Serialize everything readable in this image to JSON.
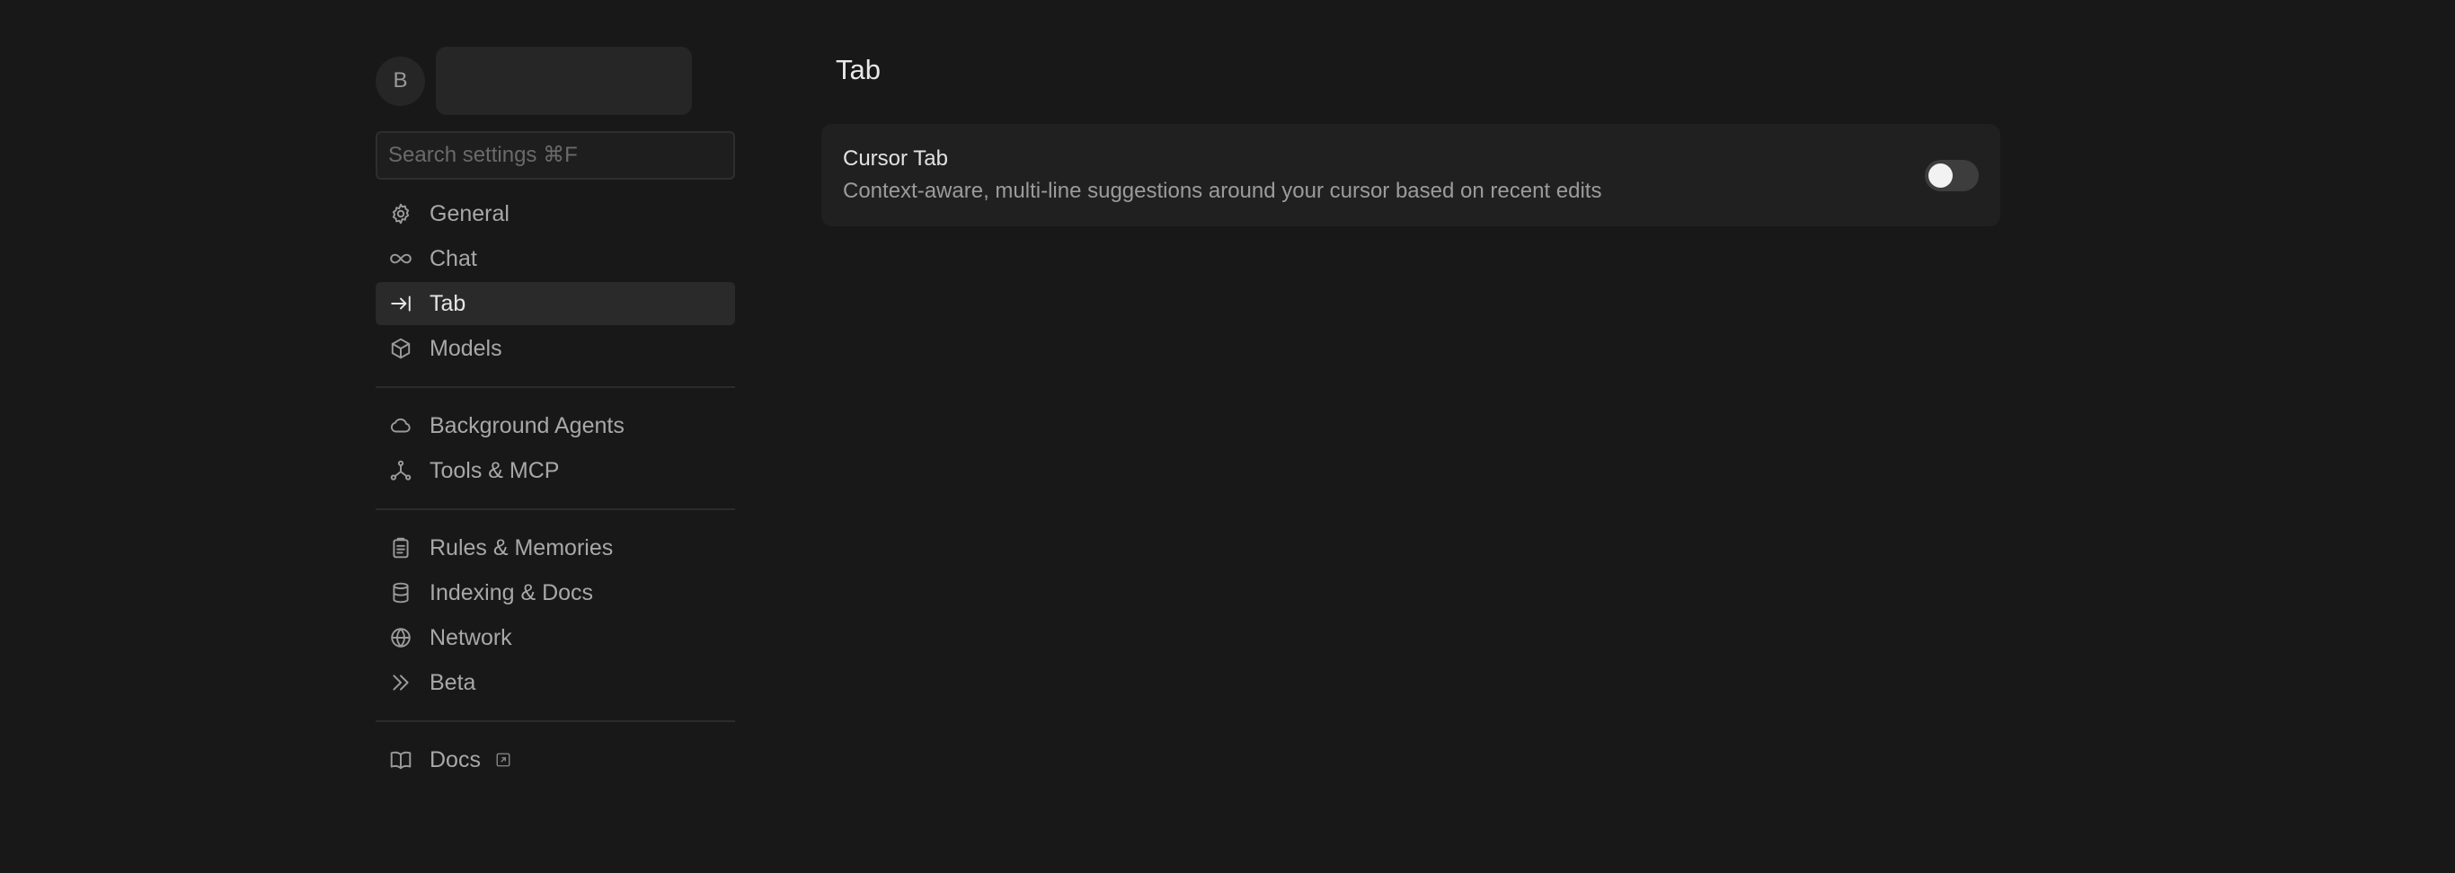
{
  "account": {
    "avatar_initial": "B"
  },
  "search": {
    "placeholder": "Search settings ⌘F"
  },
  "sidebar": {
    "items": [
      {
        "label": "General",
        "icon": "gear-icon"
      },
      {
        "label": "Chat",
        "icon": "infinity-icon"
      },
      {
        "label": "Tab",
        "icon": "arrow-right-bar-icon",
        "active": true
      },
      {
        "label": "Models",
        "icon": "cube-icon"
      },
      {
        "label": "Background Agents",
        "icon": "cloud-icon"
      },
      {
        "label": "Tools & MCP",
        "icon": "nodes-icon"
      },
      {
        "label": "Rules & Memories",
        "icon": "clipboard-icon"
      },
      {
        "label": "Indexing & Docs",
        "icon": "database-icon"
      },
      {
        "label": "Network",
        "icon": "globe-icon"
      },
      {
        "label": "Beta",
        "icon": "double-chevron-icon"
      },
      {
        "label": "Docs",
        "icon": "book-icon",
        "external": true
      }
    ]
  },
  "main": {
    "title": "Tab",
    "settings": [
      {
        "title": "Cursor Tab",
        "description": "Context-aware, multi-line suggestions around your cursor based on recent edits",
        "enabled": false
      }
    ]
  },
  "colors": {
    "background": "#181818",
    "card": "#202020",
    "active_item": "#2a2a2a",
    "toggle_off": "#3d3d3d"
  }
}
